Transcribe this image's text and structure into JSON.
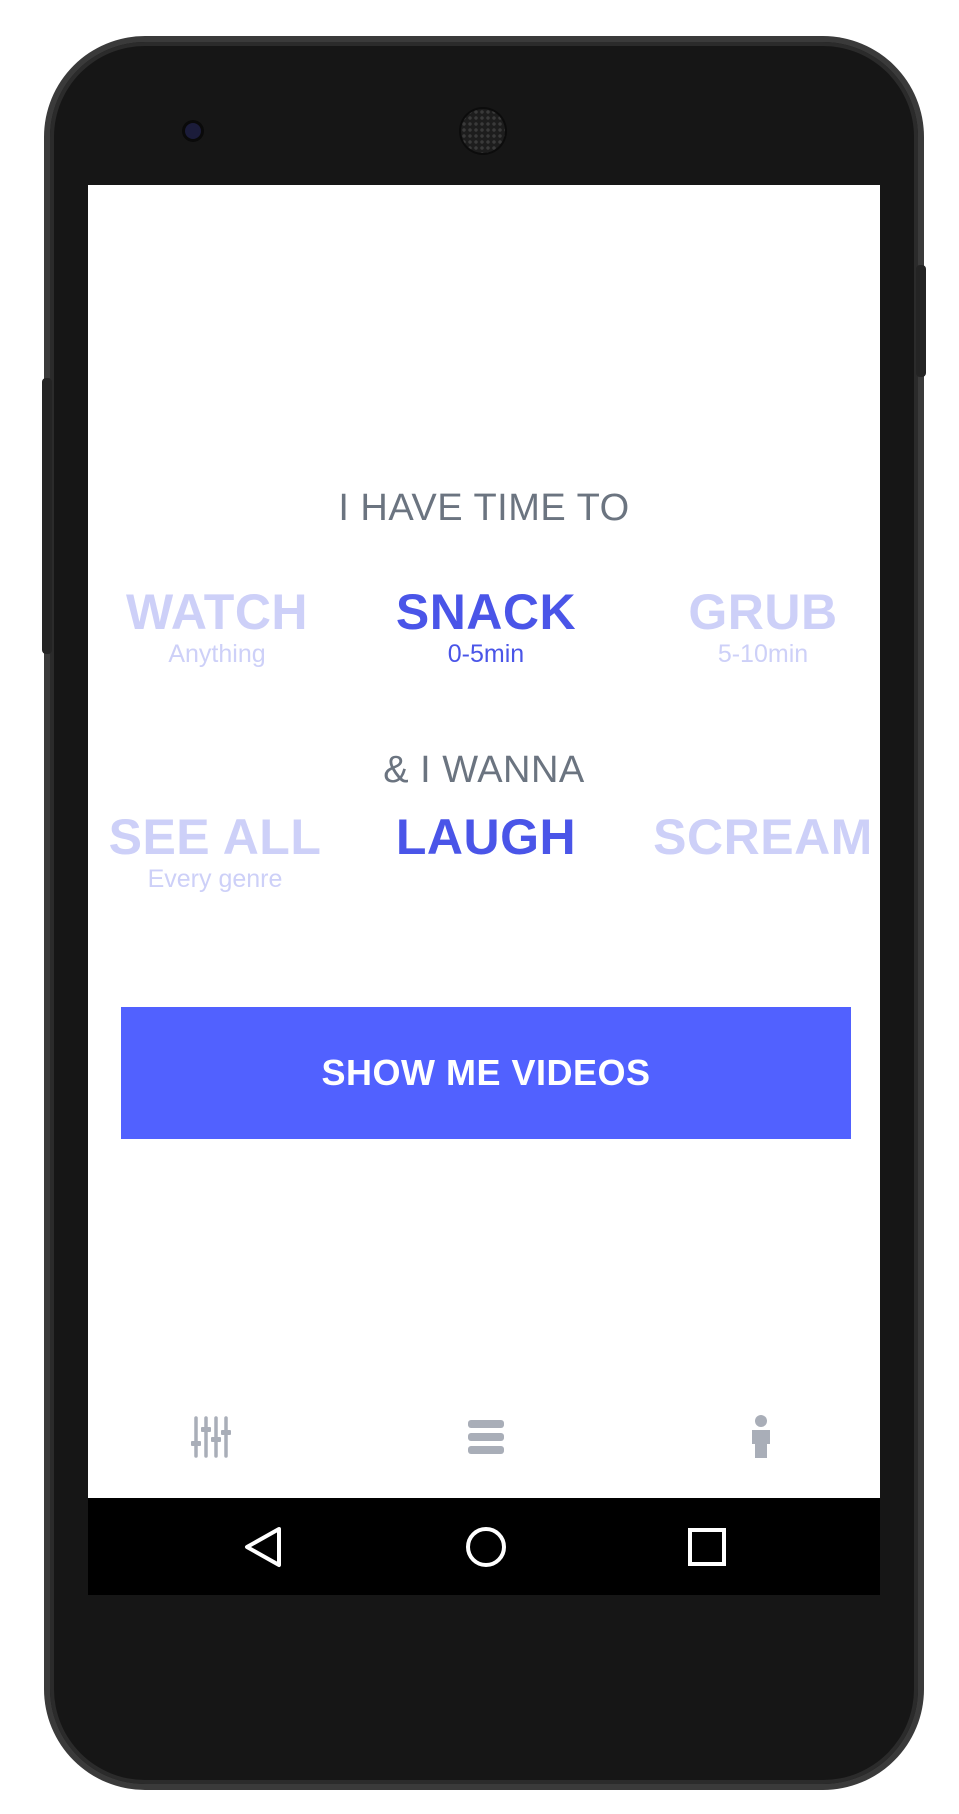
{
  "colors": {
    "accent": "#4a55e8",
    "inactive": "#cdd0f8",
    "button": "#5161ff",
    "heading": "#6b7480",
    "tab_icon": "#a9aeb8"
  },
  "time_section": {
    "heading": "I HAVE TIME TO",
    "options": [
      {
        "title": "WATCH",
        "subtitle": "Anything",
        "selected": false
      },
      {
        "title": "SNACK",
        "subtitle": "0-5min",
        "selected": true
      },
      {
        "title": "GRUB",
        "subtitle": "5-10min",
        "selected": false
      }
    ]
  },
  "mood_section": {
    "heading": "& I WANNA",
    "options": [
      {
        "title": "SEE ALL",
        "subtitle": "Every genre",
        "selected": false
      },
      {
        "title": "LAUGH",
        "subtitle": "",
        "selected": true
      },
      {
        "title": "SCREAM",
        "subtitle": "",
        "selected": false
      }
    ]
  },
  "cta": {
    "label": "SHOW ME VIDEOS"
  },
  "bottom_tabs": [
    {
      "icon": "sliders-icon"
    },
    {
      "icon": "list-icon"
    },
    {
      "icon": "person-icon"
    }
  ],
  "system_nav": [
    {
      "icon": "back-icon"
    },
    {
      "icon": "home-icon"
    },
    {
      "icon": "recents-icon"
    }
  ]
}
